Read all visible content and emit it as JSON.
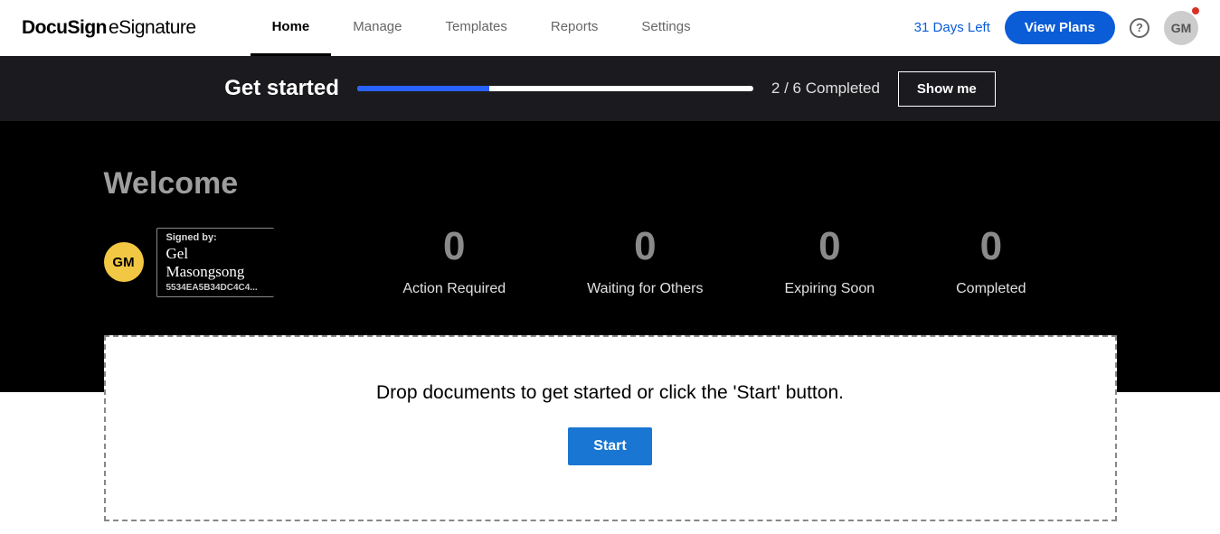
{
  "header": {
    "logo_bold": "DocuSign",
    "logo_thin": "eSignature",
    "nav": [
      "Home",
      "Manage",
      "Templates",
      "Reports",
      "Settings"
    ],
    "active_nav": "Home",
    "days_left": "31 Days Left",
    "view_plans": "View Plans",
    "avatar_initials": "GM"
  },
  "get_started": {
    "title": "Get started",
    "progress_pct": 33.3,
    "count_text": "2 / 6 Completed",
    "show_me": "Show me"
  },
  "welcome": {
    "title": "Welcome",
    "avatar_initials": "GM",
    "signed_by_label": "Signed by:",
    "signature_name": "Gel Masongsong",
    "signature_hash": "5534EA5B34DC4C4..."
  },
  "stats": [
    {
      "value": "0",
      "label": "Action Required"
    },
    {
      "value": "0",
      "label": "Waiting for Others"
    },
    {
      "value": "0",
      "label": "Expiring Soon"
    },
    {
      "value": "0",
      "label": "Completed"
    }
  ],
  "drop": {
    "text": "Drop documents to get started or click the 'Start' button.",
    "button": "Start"
  }
}
